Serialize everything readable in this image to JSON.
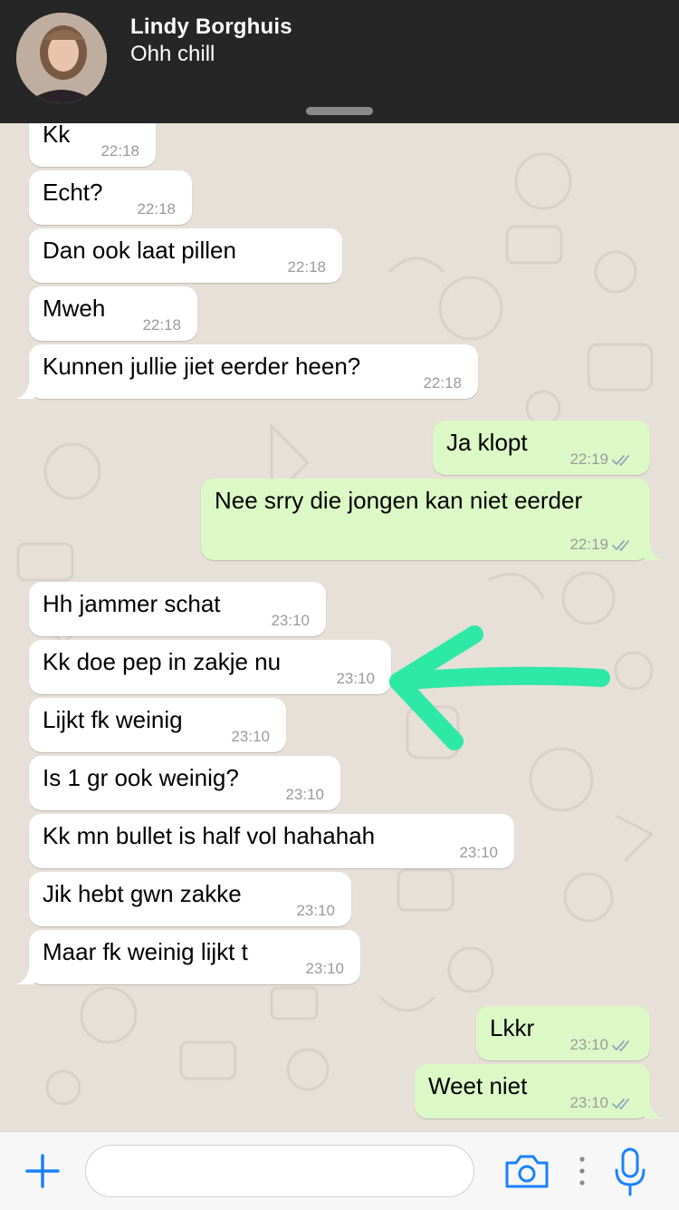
{
  "notification": {
    "sender": "Lindy Borghuis",
    "message": "Ohh chill"
  },
  "messages": [
    {
      "direction": "in",
      "text": "Kk",
      "time": "22:18"
    },
    {
      "direction": "in",
      "text": "Echt?",
      "time": "22:18"
    },
    {
      "direction": "in",
      "text": "Dan ook laat pillen",
      "time": "22:18"
    },
    {
      "direction": "in",
      "text": "Mweh",
      "time": "22:18"
    },
    {
      "direction": "in",
      "text": "Kunnen jullie jiet eerder heen?",
      "time": "22:18"
    },
    {
      "direction": "out",
      "text": "Ja klopt",
      "time": "22:19"
    },
    {
      "direction": "out",
      "text": "Nee srry die jongen kan niet eerder",
      "time": "22:19"
    },
    {
      "direction": "in",
      "text": "Hh jammer schat",
      "time": "23:10"
    },
    {
      "direction": "in",
      "text": "Kk doe pep in zakje nu",
      "time": "23:10"
    },
    {
      "direction": "in",
      "text": "Lijkt fk weinig",
      "time": "23:10"
    },
    {
      "direction": "in",
      "text": "Is 1 gr ook weinig?",
      "time": "23:10"
    },
    {
      "direction": "in",
      "text": "Kk mn bullet is half vol hahahah",
      "time": "23:10"
    },
    {
      "direction": "in",
      "text": "Jik hebt gwn zakke",
      "time": "23:10"
    },
    {
      "direction": "in",
      "text": "Maar fk weinig lijkt t",
      "time": "23:10"
    },
    {
      "direction": "out",
      "text": "Lkkr",
      "time": "23:10"
    },
    {
      "direction": "out",
      "text": "Weet niet",
      "time": "23:10"
    }
  ],
  "input_bar": {
    "message_placeholder": "",
    "icons": [
      "plus-icon",
      "camera-icon",
      "more-dots-icon",
      "microphone-icon"
    ]
  },
  "colors": {
    "incoming_bubble": "#ffffff",
    "outgoing_bubble": "#dcf8c6",
    "chat_background": "#e6e0d8",
    "banner_background": "#262626",
    "accent_blue": "#1a82fb",
    "annotation_arrow": "#2ee8a6",
    "read_ticks": "#8ea6b8"
  }
}
